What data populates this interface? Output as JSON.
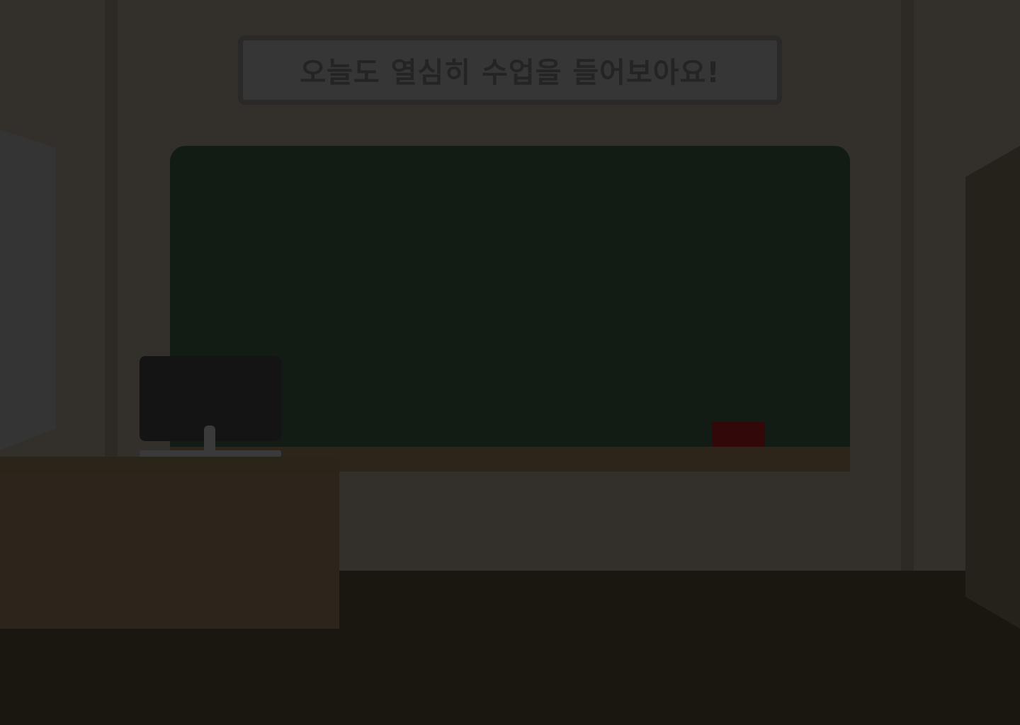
{
  "sign": {
    "text": "오늘도 열심히 수업을 들어보아요!"
  },
  "colors": {
    "wall": "#33302b",
    "floor": "#1a1710",
    "chalkboard": "#121c14",
    "chalk_tray": "#2d251a",
    "eraser": "#330808",
    "desk": "#2d251c",
    "monitor": "#141414",
    "sign_background": "#363636",
    "sign_text": "#242424"
  }
}
